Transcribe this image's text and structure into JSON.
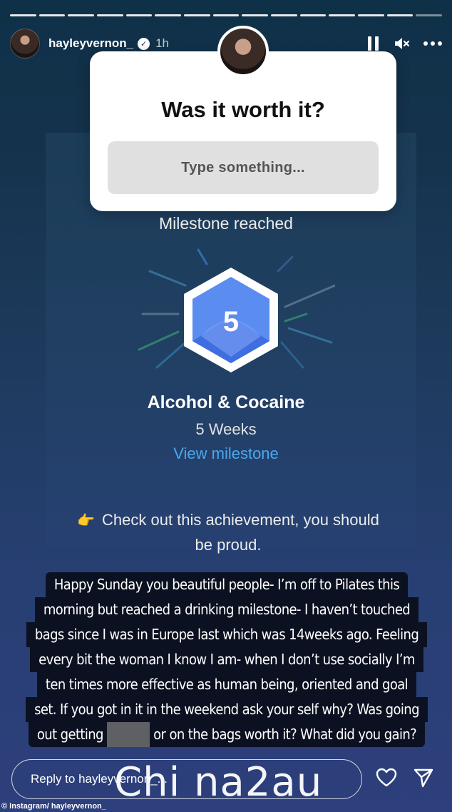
{
  "story": {
    "progress": {
      "filled_segments": 14,
      "total_segments": 15
    }
  },
  "header": {
    "username": "hayleyvernon_",
    "timestamp": "1h",
    "verified_icon": "verified-check-icon",
    "actions": [
      "pause-icon",
      "mute-icon",
      "more-icon"
    ]
  },
  "question": {
    "title": "Was it worth it?",
    "placeholder": "Type something..."
  },
  "milestone": {
    "header": "Milestone reached",
    "badge_number": "5",
    "title": "Alcohol & Cocaine",
    "duration": "5 Weeks",
    "link_label": "View milestone",
    "badge_color": "#5b8cf0",
    "link_color": "#4aa8ee"
  },
  "achievement": {
    "icon": "pointing-hand-icon",
    "icon_glyph": "👉",
    "text": "Check out this achievement, you should be proud."
  },
  "caption": {
    "lines": [
      "Happy Sunday you beautiful people- I’m off to Pilates this",
      "morning but reached a drinking milestone- I haven’t touched",
      "bags since I was in Europe last which was 14weeks ago. Feeling",
      "every bit the woman I know I am- when I don’t use socially I’m",
      "ten times more effective as human being, oriented and goal",
      "set. If you got in it in the weekend ask your self why? Was going"
    ],
    "last_line_before": "out getting",
    "last_line_after": "or on the bags worth it? What did you gain?"
  },
  "reply": {
    "placeholder": "Reply to hayleyvernon_..."
  },
  "watermark": "Chi na2au",
  "credit": "© Instagram/ hayleyvernon_"
}
